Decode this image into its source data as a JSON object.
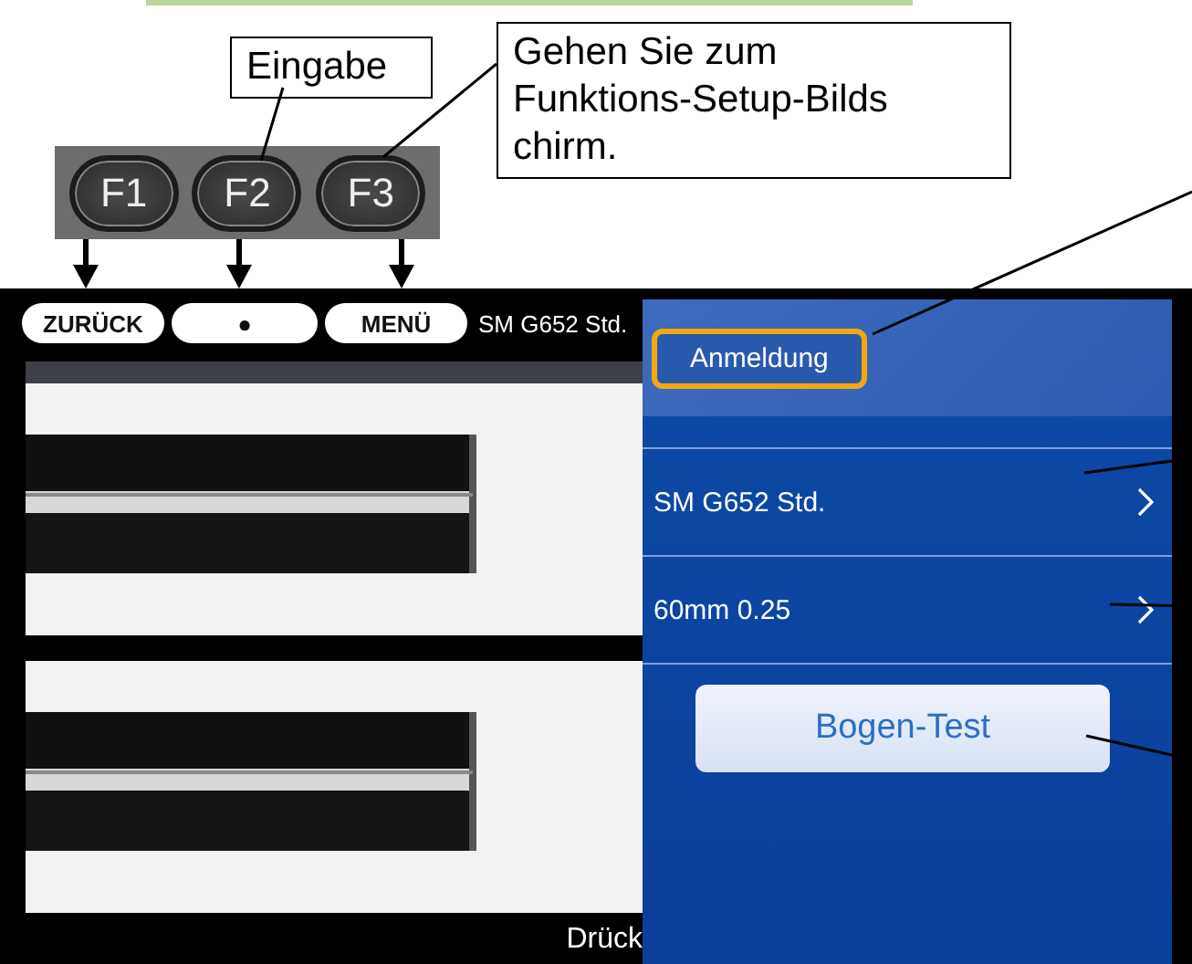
{
  "callouts": [
    {
      "text": "Eingabe"
    },
    {
      "text": "Gehen Sie zum\nFunktions-Setup-Bilds\nchirm."
    }
  ],
  "function_keys": [
    "F1",
    "F2",
    "F3"
  ],
  "screen": {
    "top_buttons": [
      {
        "label": "ZURÜCK"
      },
      {
        "label": "●"
      },
      {
        "label": "MENÜ"
      }
    ],
    "fiber_label": "SM G652 Std.",
    "status": "Drück",
    "menu": {
      "title": "Anmeldung",
      "highlighted": true,
      "items": [
        {
          "label": "SM G652 Std.",
          "kind": "link"
        },
        {
          "label": "60mm 0.25",
          "kind": "link"
        },
        {
          "label": "Bogen-Test",
          "kind": "button"
        }
      ]
    }
  }
}
